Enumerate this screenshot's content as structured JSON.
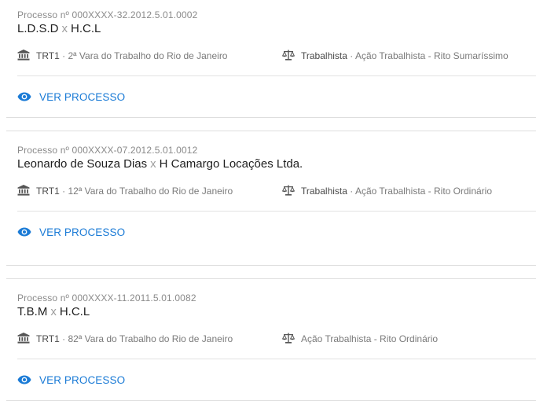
{
  "processes": [
    {
      "number": "Processo nº 000XXXX-32.2012.5.01.0002",
      "plaintiff": "L.D.S.D",
      "separator": "x",
      "defendant": "H.C.L",
      "court_prefix": "TRT1",
      "court_sep": " · ",
      "court_name": "2ª Vara do Trabalho do Rio de Janeiro",
      "area": "Trabalhista",
      "area_sep": " · ",
      "action": "Ação Trabalhista - Rito Sumaríssimo",
      "view_label": "VER PROCESSO",
      "court_icon": "courthouse-icon",
      "area_icon": "scale-icon",
      "view_icon": "eye-icon"
    },
    {
      "number": "Processo nº 000XXXX-07.2012.5.01.0012",
      "plaintiff": "Leonardo de Souza Dias",
      "separator": "x",
      "defendant": "H Camargo Locações Ltda.",
      "court_prefix": "TRT1",
      "court_sep": " · ",
      "court_name": "12ª Vara do Trabalho do Rio de Janeiro",
      "area": "Trabalhista",
      "area_sep": " · ",
      "action": "Ação Trabalhista - Rito Ordinário",
      "view_label": "VER PROCESSO",
      "court_icon": "courthouse-icon",
      "area_icon": "scale-icon",
      "view_icon": "eye-icon"
    },
    {
      "number": "Processo nº 000XXXX-11.2011.5.01.0082",
      "plaintiff": "T.B.M",
      "separator": "x",
      "defendant": "H.C.L",
      "court_prefix": "TRT1",
      "court_sep": " · ",
      "court_name": "82ª Vara do Trabalho do Rio de Janeiro",
      "area": "",
      "area_sep": "",
      "action": "Ação Trabalhista - Rito Ordinário",
      "view_label": "VER PROCESSO",
      "court_icon": "courthouse-icon",
      "area_icon": "scale-icon",
      "view_icon": "eye-icon"
    }
  ],
  "colors": {
    "link": "#1b7bd6",
    "muted": "#8a8a8a",
    "divider": "#e2e2e2"
  }
}
